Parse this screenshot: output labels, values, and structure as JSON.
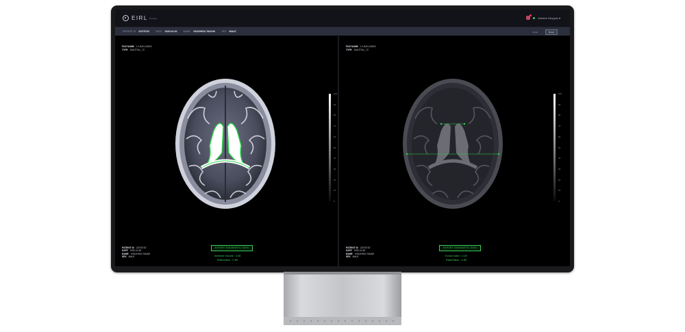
{
  "app": {
    "logo_text": "EIRL",
    "logo_sub": "Viewer",
    "user_name": "Antoine Dhoppin ▾",
    "notification_count": "1"
  },
  "infobar": {
    "patient_id_label": "PATIENT ID",
    "patient_id": "22375702",
    "date_label": "DATE",
    "date": "2020.04.26",
    "name_label": "NAME",
    "name": "YASUHISA TAKAKI",
    "sex_label": "SEX",
    "sex": "MALE",
    "btn_1": "Mode",
    "btn_2": "Reset"
  },
  "left_panel": {
    "file_name_label": "FILE NAME",
    "file_name": "1.2.840.113619",
    "type_label": "TYPE",
    "type": "SAGITTAL_T2",
    "report_button": "EXPORT DIAGNOSTIC DATA",
    "result_1": "Ventricle Volume : 0.85",
    "result_2": "Ratio/Value : 0.85",
    "patient_id_label": "PATIENT ID",
    "patient_id": "22375702",
    "date_label": "DATE",
    "date": "2020.04.26",
    "name_label": "NAME",
    "name": "YASUHISA TAKAKI",
    "sex_label": "SEX",
    "sex": "MALE"
  },
  "right_panel": {
    "file_name_label": "FILE NAME",
    "file_name": "1.2.840.113619",
    "type_label": "TYPE",
    "type": "SAGITTAL_T2",
    "report_button": "EXPORT DIAGNOSTIC DATA",
    "result_1": "Evans Index : 0.29",
    "result_2": "Ratio/Value : 4.85",
    "patient_id_label": "PATIENT ID",
    "patient_id": "22375702",
    "date_label": "DATE",
    "date": "2020.04.26",
    "name_label": "NAME",
    "name": "YASUHISA TAKAKI",
    "sex_label": "SEX",
    "sex": "MALE"
  },
  "scale_ticks": [
    "100",
    "90",
    "80",
    "70",
    "60",
    "50",
    "40",
    "30",
    "20",
    "10",
    "0"
  ],
  "colors": {
    "accent_green": "#3ccf5a",
    "infobar_bg": "#2b2f3d",
    "topbar_bg": "#121219"
  }
}
